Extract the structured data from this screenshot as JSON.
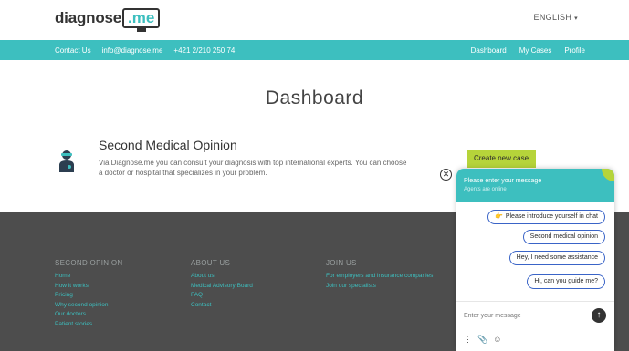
{
  "header": {
    "logo_text": "diagnose",
    "logo_screen": ".me",
    "language": "ENGLISH",
    "language_caret": "▾"
  },
  "nav": {
    "left": [
      "Contact Us",
      "info@diagnose.me",
      "+421 2/210 250 74"
    ],
    "right": [
      "Dashboard",
      "My Cases",
      "Profile"
    ]
  },
  "main": {
    "title": "Dashboard",
    "card": {
      "title": "Second Medical Opinion",
      "description": "Via Diagnose.me you can consult your diagnosis with top international experts. You can choose a doctor or hospital that specializes in your problem.",
      "button": "Create new case",
      "icon": "doctor-icon"
    }
  },
  "footer": {
    "columns": [
      {
        "heading": "SECOND OPINION",
        "links": [
          "Home",
          "How it works",
          "Pricing",
          "Why second opinion",
          "Our doctors",
          "Patient stories"
        ]
      },
      {
        "heading": "ABOUT US",
        "links": [
          "About us",
          "Medical Advisory Board",
          "FAQ",
          "Contact"
        ]
      },
      {
        "heading": "JOIN US",
        "links": [
          "For employers and insurance companies",
          "Join our specialists"
        ]
      }
    ]
  },
  "chat": {
    "close_glyph": "✕",
    "title": "Please enter your message",
    "subtitle": "Agents are online",
    "options": [
      {
        "hand": "👉",
        "label": "Please introduce yourself in chat"
      },
      {
        "label": "Second medical opinion"
      },
      {
        "label": "Hey, I need some assistance"
      },
      {
        "label": "Hi, can you guide me?"
      }
    ],
    "input_placeholder": "Enter your message",
    "send_glyph": "↑",
    "tools": {
      "menu": "⋮",
      "attach": "📎",
      "emoji": "☺"
    }
  },
  "colors": {
    "teal": "#3dbfbf",
    "lime": "#b6d43a",
    "footer": "#4d4d4d",
    "pill_border": "#3a64c7"
  }
}
